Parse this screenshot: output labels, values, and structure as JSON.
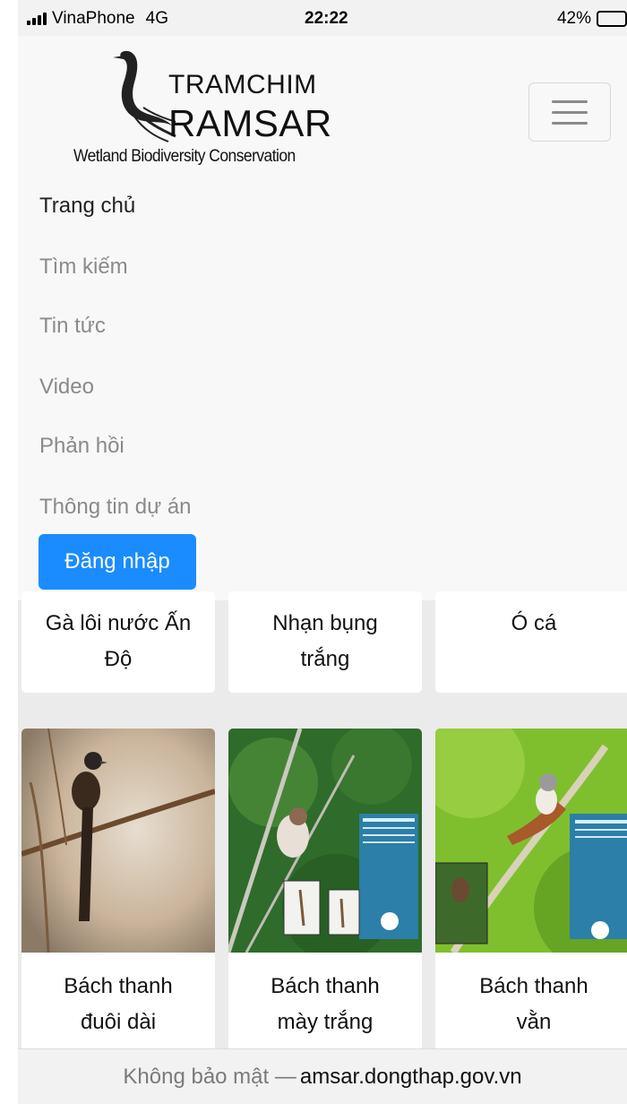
{
  "status_bar": {
    "carrier": "VinaPhone",
    "network": "4G",
    "time": "22:22",
    "battery": "42%",
    "battery_level": 0.42
  },
  "header": {
    "logo_line1": "TRAMCHIM",
    "logo_line2": "RAMSAR",
    "logo_tagline": "Wetland Biodiversity Conservation",
    "menu_icon": "hamburger-icon"
  },
  "nav": {
    "items": [
      {
        "label": "Trang chủ",
        "active": true
      },
      {
        "label": "Tìm kiếm",
        "active": false
      },
      {
        "label": "Tin tức",
        "active": false
      },
      {
        "label": "Video",
        "active": false
      },
      {
        "label": "Phản hồi",
        "active": false
      },
      {
        "label": "Thông tin dự án",
        "active": false
      }
    ],
    "login_label": "Đăng nhập"
  },
  "cards_row1": [
    {
      "title_l1": "Gà lôi nước Ấn",
      "title_l2": "Độ"
    },
    {
      "title_l1": "Nhạn bụng",
      "title_l2": "trắng"
    },
    {
      "title_l1": "Ó cá",
      "title_l2": ""
    }
  ],
  "cards_row2": [
    {
      "title_l1": "Bách thanh",
      "title_l2": "đuôi dài"
    },
    {
      "title_l1": "Bách thanh",
      "title_l2": "mày trắng"
    },
    {
      "title_l1": "Bách thanh",
      "title_l2": "vằn"
    }
  ],
  "url_bar": {
    "security": "Không bảo mật —",
    "host": "amsar.dongthap.gov.vn"
  },
  "colors": {
    "accent": "#1a8cff",
    "nav_bg": "#f8f8f8",
    "content_bg": "#ebebeb"
  }
}
